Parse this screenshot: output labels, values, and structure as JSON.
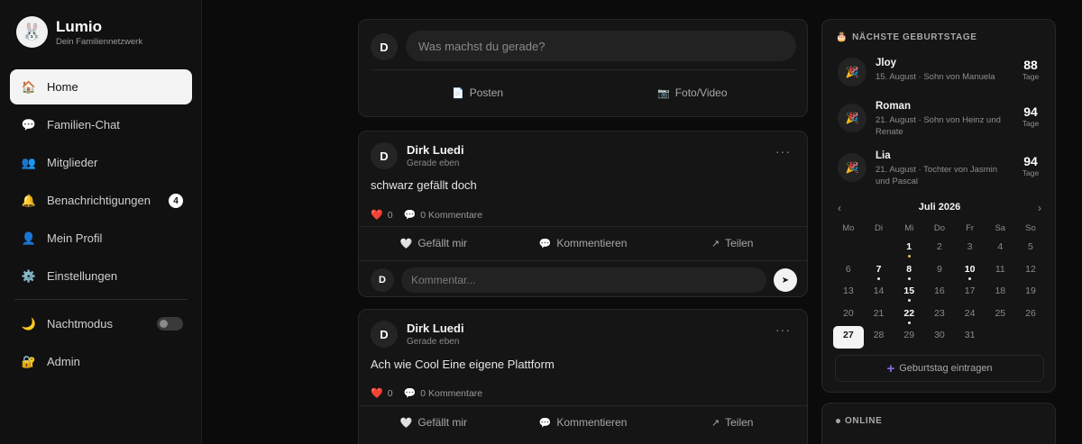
{
  "brand": {
    "name": "Lumio",
    "tagline": "Dein Familiennetzwerk",
    "logo_icon": "bunny-icon"
  },
  "nav": [
    {
      "label": "Home",
      "icon": "house-icon",
      "active": true
    },
    {
      "label": "Familien-Chat",
      "icon": "speech-bubble-icon"
    },
    {
      "label": "Mitglieder",
      "icon": "people-icon"
    },
    {
      "label": "Benachrichtigungen",
      "icon": "bell-icon",
      "badge": "4"
    },
    {
      "label": "Mein Profil",
      "icon": "person-icon"
    },
    {
      "label": "Einstellungen",
      "icon": "gear-icon"
    }
  ],
  "nav2": {
    "night_mode": "Nachtmodus",
    "admin": "Admin"
  },
  "composer": {
    "avatar": "D",
    "placeholder": "Was machst du gerade?",
    "post_label": "Posten",
    "photo_label": "Foto/Video"
  },
  "posts": [
    {
      "avatar": "D",
      "author": "Dirk Luedi",
      "time": "Gerade eben",
      "text": "schwarz gefällt doch",
      "likes": "0",
      "comments": "0 Kommentare",
      "like_label": "Gefällt mir",
      "comment_label": "Kommentieren",
      "share_label": "Teilen",
      "comment_placeholder": "Kommentar...",
      "comment_avatar": "D"
    },
    {
      "avatar": "D",
      "author": "Dirk Luedi",
      "time": "Gerade eben",
      "text": "Ach wie Cool Eine eigene Plattform",
      "likes": "0",
      "comments": "0 Kommentare",
      "like_label": "Gefällt mir",
      "comment_label": "Kommentieren",
      "share_label": "Teilen"
    }
  ],
  "birthdays": {
    "title": "NÄCHSTE GEBURTSTAGE",
    "items": [
      {
        "name": "Jloy",
        "desc": "15. August · Sohn von Manuela",
        "days": "88",
        "unit": "Tage"
      },
      {
        "name": "Roman",
        "desc": "21. August · Sohn von Heinz und Renate",
        "days": "94",
        "unit": "Tage"
      },
      {
        "name": "Lia",
        "desc": "21. August · Tochter von Jasmin und Pascal",
        "days": "94",
        "unit": "Tage"
      }
    ],
    "calendar": {
      "month": "Juli 2026",
      "prev": "‹",
      "next": "›",
      "dow": [
        "Mo",
        "Di",
        "Mi",
        "Do",
        "Fr",
        "Sa",
        "So"
      ],
      "weeks": [
        [
          "",
          "",
          "1",
          "2",
          "3",
          "4",
          "5"
        ],
        [
          "6",
          "7",
          "8",
          "9",
          "10",
          "11",
          "12"
        ],
        [
          "13",
          "14",
          "15",
          "16",
          "17",
          "18",
          "19"
        ],
        [
          "20",
          "21",
          "22",
          "23",
          "24",
          "25",
          "26"
        ],
        [
          "27",
          "28",
          "29",
          "30",
          "31",
          "",
          ""
        ]
      ],
      "marked": [
        "1",
        "7",
        "8",
        "10",
        "15",
        "22"
      ],
      "marked_accent": [
        "1"
      ],
      "today": "27"
    },
    "add_label": "Geburtstag eintragen"
  },
  "online": {
    "title": "ONLINE"
  }
}
